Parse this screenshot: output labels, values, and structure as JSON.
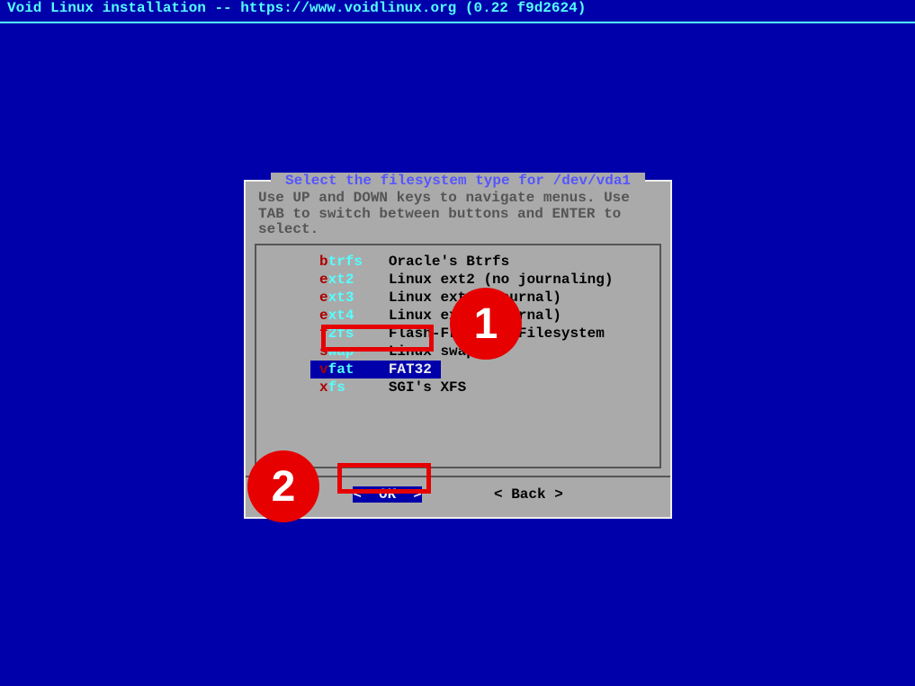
{
  "header": "Void Linux installation -- https://www.voidlinux.org (0.22 f9d2624)",
  "dialog": {
    "title": " Select the filesystem type for /dev/vda1 ",
    "instructions": "Use UP and DOWN keys to navigate menus. Use TAB to switch between buttons and ENTER to select.",
    "items": [
      {
        "first": "b",
        "rest": "trfs",
        "desc": "Oracle's Btrfs",
        "selected": false
      },
      {
        "first": "e",
        "rest": "xt2",
        "desc": "Linux ext2 (no journaling)",
        "selected": false
      },
      {
        "first": "e",
        "rest": "xt3",
        "desc": "Linux ext3 (journal)",
        "selected": false
      },
      {
        "first": "e",
        "rest": "xt4",
        "desc": "Linux ext4 (journal)",
        "selected": false
      },
      {
        "first": "f",
        "rest": "2fs",
        "desc": "Flash-Friendly Filesystem",
        "selected": false
      },
      {
        "first": "s",
        "rest": "wap",
        "desc": "Linux swap",
        "selected": false
      },
      {
        "first": "v",
        "rest": "fat",
        "desc": "FAT32",
        "selected": true
      },
      {
        "first": "x",
        "rest": "fs",
        "desc": "SGI's XFS",
        "selected": false
      }
    ],
    "ok_label": "<  OK  >",
    "back_label": "< Back >"
  },
  "annotations": {
    "a1": "1",
    "a2": "2"
  }
}
